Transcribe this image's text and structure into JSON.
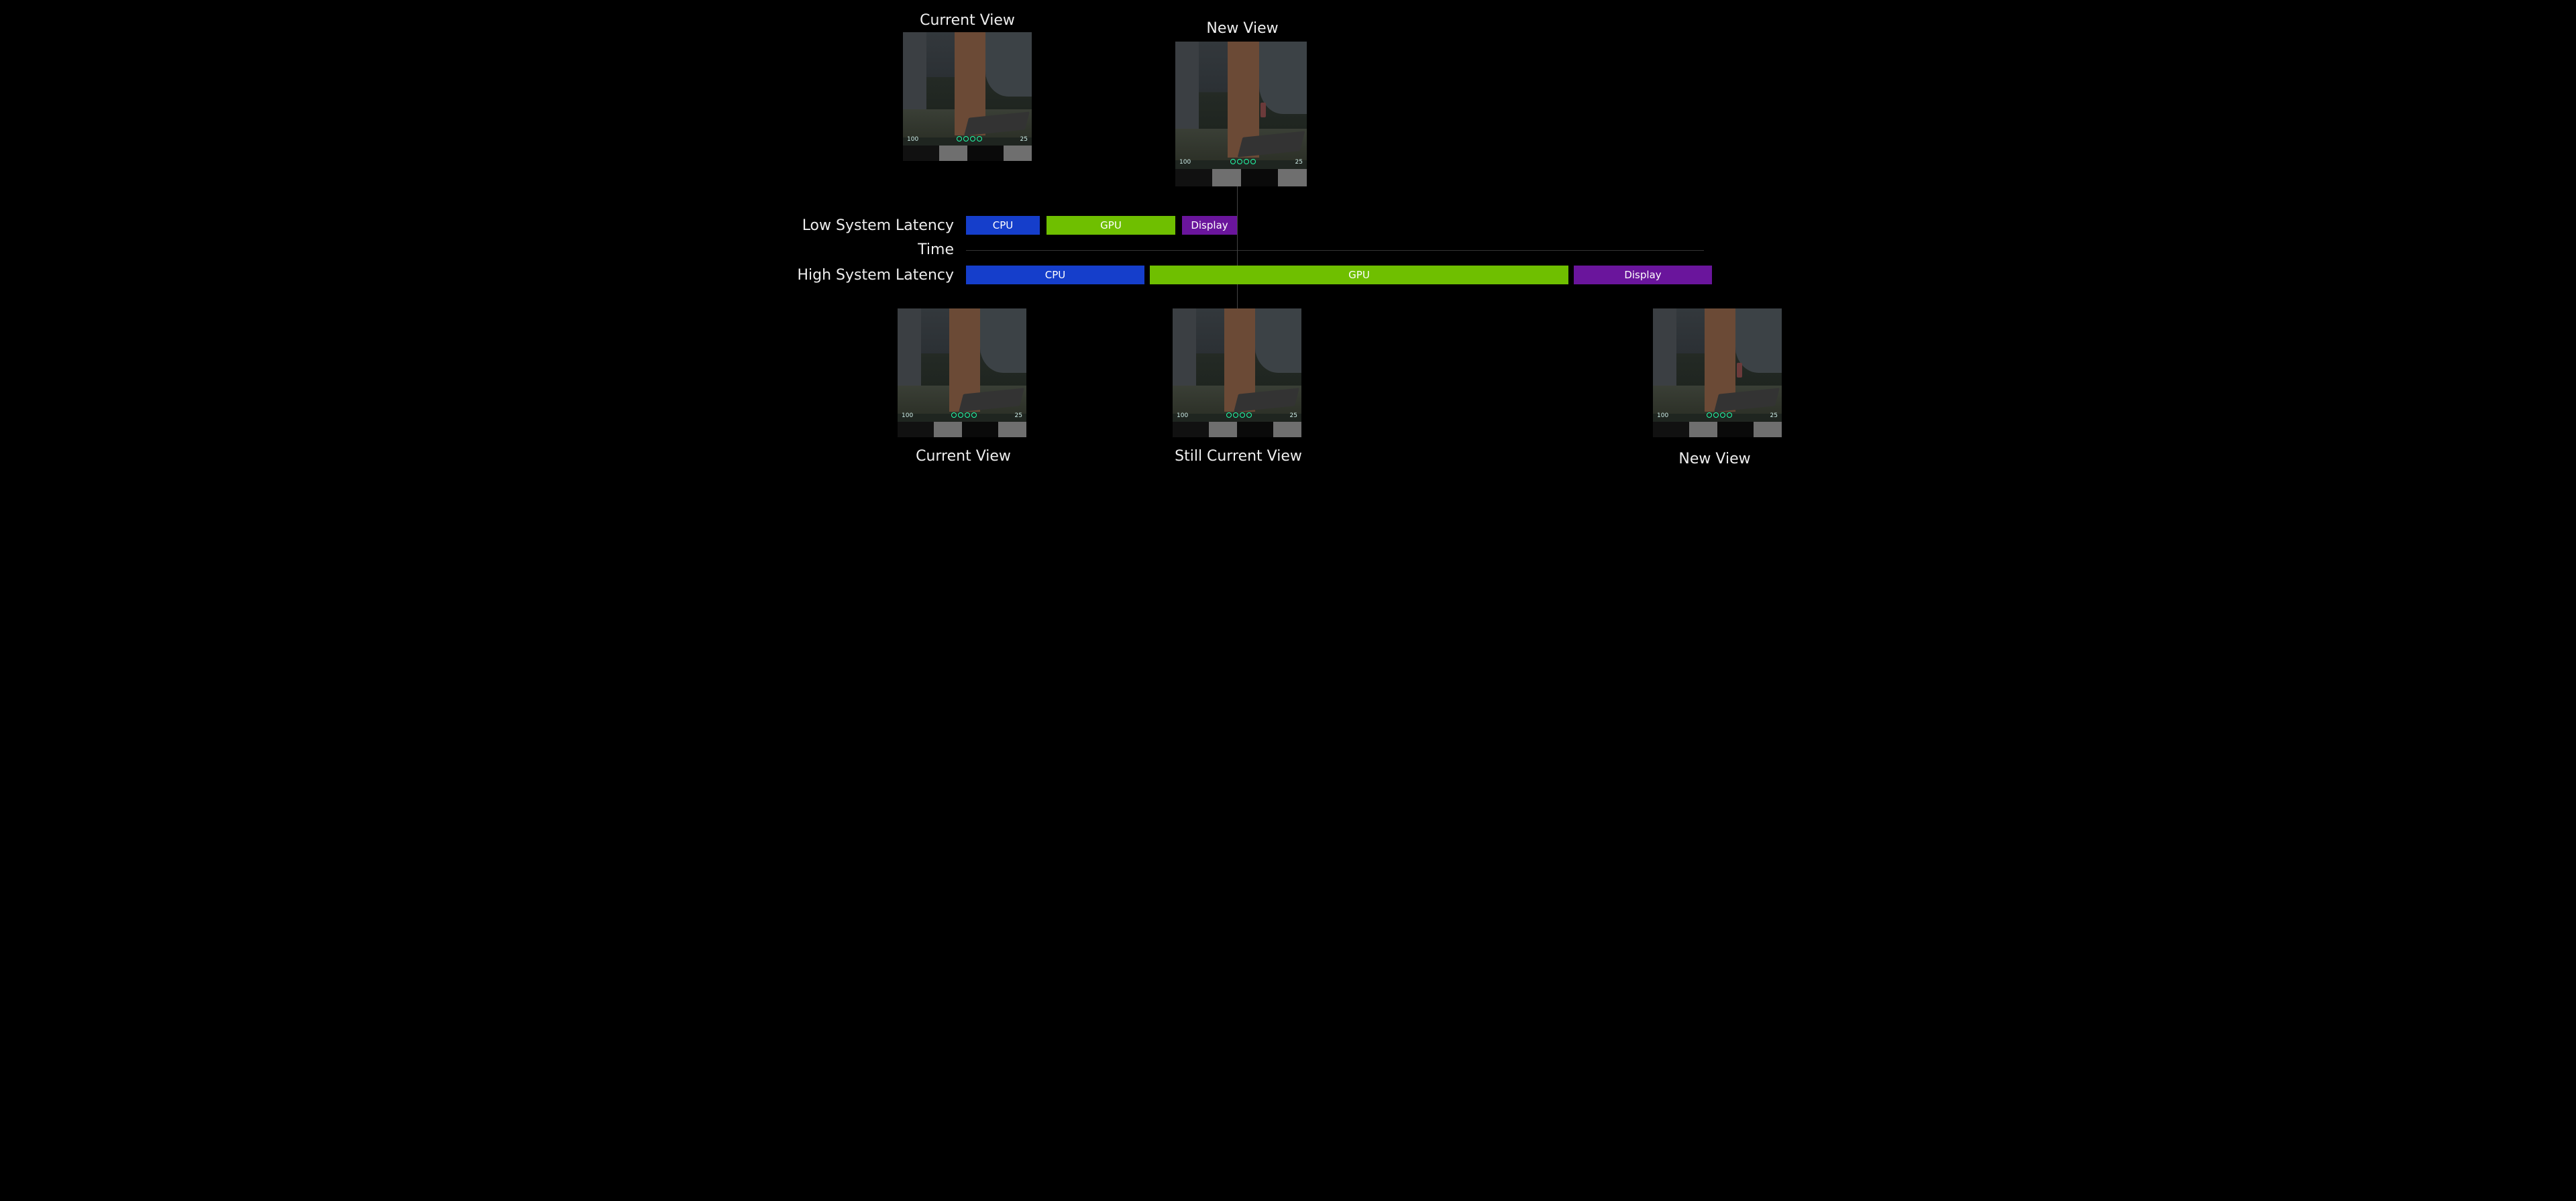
{
  "top": {
    "current": "Current View",
    "new": "New View"
  },
  "rows": {
    "low_label": "Low System Latency",
    "high_label": "High System Latency",
    "time_label": "Time"
  },
  "segments": {
    "cpu": "CPU",
    "gpu": "GPU",
    "display": "Display"
  },
  "bottom": {
    "current": "Current View",
    "still": "Still Current View",
    "new": "New View"
  },
  "hud": {
    "hp": "100",
    "ammo": "25"
  },
  "colors": {
    "cpu": "#153ecb",
    "gpu": "#6fbf00",
    "display": "#6a159c"
  }
}
